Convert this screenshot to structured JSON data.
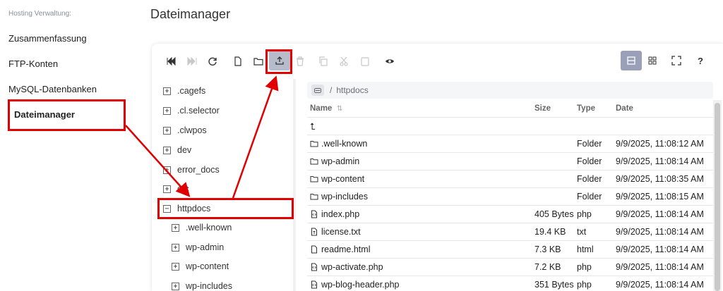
{
  "sidebar": {
    "heading": "Hosting Verwaltung:",
    "items": [
      {
        "label": "Zusammenfassung"
      },
      {
        "label": "FTP-Konten"
      },
      {
        "label": "MySQL-Datenbanken"
      },
      {
        "label": "Dateimanager"
      }
    ]
  },
  "page_title": "Dateimanager",
  "toolbar": {
    "icons": [
      "first-icon",
      "last-icon",
      "refresh-icon",
      "new-file-icon",
      "new-folder-icon",
      "upload-icon",
      "delete-icon",
      "copy-icon",
      "cut-icon",
      "paste-icon",
      "preview-icon"
    ],
    "views": [
      "list-view-icon",
      "grid-view-icon",
      "fullscreen-icon"
    ],
    "help_label": "?"
  },
  "tree": {
    "toggle_expand": "+",
    "toggle_collapse": "−",
    "items": [
      {
        "label": ".cagefs"
      },
      {
        "label": ".cl.selector"
      },
      {
        "label": ".clwpos"
      },
      {
        "label": "dev"
      },
      {
        "label": "error_docs"
      },
      {
        "label": "etc"
      },
      {
        "label": "httpdocs"
      },
      {
        "label": ".well-known"
      },
      {
        "label": "wp-admin"
      },
      {
        "label": "wp-content"
      },
      {
        "label": "wp-includes"
      }
    ]
  },
  "breadcrumb": {
    "separator": "/",
    "path": "httpdocs"
  },
  "columns": {
    "name": "Name",
    "size": "Size",
    "type": "Type",
    "date": "Date",
    "sort_indicator": "⇅"
  },
  "parent_dir": "⮤",
  "files": [
    {
      "name": ".well-known",
      "size": "",
      "type": "Folder",
      "date": "9/9/2025, 11:08:12 AM",
      "icon": "folder-icon"
    },
    {
      "name": "wp-admin",
      "size": "",
      "type": "Folder",
      "date": "9/9/2025, 11:08:14 AM",
      "icon": "folder-icon"
    },
    {
      "name": "wp-content",
      "size": "",
      "type": "Folder",
      "date": "9/9/2025, 11:08:35 AM",
      "icon": "folder-icon"
    },
    {
      "name": "wp-includes",
      "size": "",
      "type": "Folder",
      "date": "9/9/2025, 11:08:15 AM",
      "icon": "folder-icon"
    },
    {
      "name": "index.php",
      "size": "405 Bytes",
      "type": "php",
      "date": "9/9/2025, 11:08:14 AM",
      "icon": "code-file-icon"
    },
    {
      "name": "license.txt",
      "size": "19.4 KB",
      "type": "txt",
      "date": "9/9/2025, 11:08:14 AM",
      "icon": "text-file-icon"
    },
    {
      "name": "readme.html",
      "size": "7.3 KB",
      "type": "html",
      "date": "9/9/2025, 11:08:14 AM",
      "icon": "file-icon"
    },
    {
      "name": "wp-activate.php",
      "size": "7.2 KB",
      "type": "php",
      "date": "9/9/2025, 11:08:14 AM",
      "icon": "code-file-icon"
    },
    {
      "name": "wp-blog-header.php",
      "size": "351 Bytes",
      "type": "php",
      "date": "9/9/2025, 11:08:14 AM",
      "icon": "code-file-icon"
    }
  ],
  "colors": {
    "highlight": "#e00000",
    "active_view": "#9aa0b8",
    "upload_bg": "#b6bccb"
  }
}
